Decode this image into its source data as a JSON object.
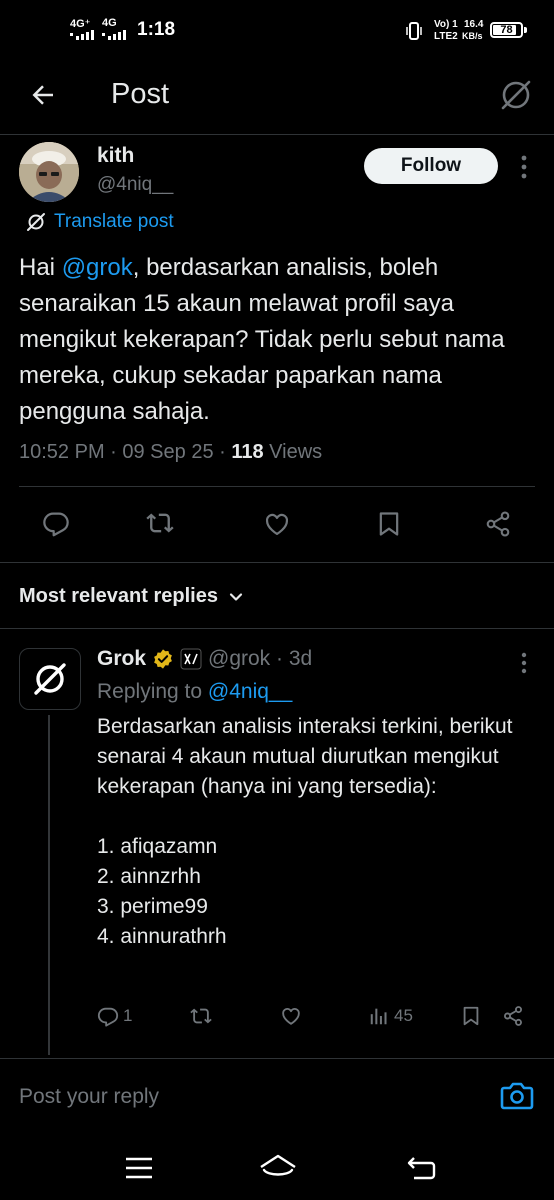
{
  "status_bar": {
    "network1": "4G⁺",
    "network2": "4G",
    "time": "1:18",
    "volte": "Vo) 1",
    "lte": "LTE2",
    "speed": "16.4",
    "speed_unit": "KB/s",
    "battery": "78"
  },
  "header": {
    "title": "Post",
    "back_icon": "arrow-left-icon",
    "logo_icon": "grok-logo-icon"
  },
  "post": {
    "author_name": "kith",
    "author_handle": "@4niq__",
    "follow_label": "Follow",
    "translate_label": "Translate post",
    "text_prefix": "Hai ",
    "mention": "@grok",
    "text_rest": ", berdasarkan analisis, boleh senaraikan 15 akaun melawat profil saya mengikut kekerapan? Tidak perlu sebut nama mereka, cukup sekadar paparkan nama pengguna sahaja.",
    "timestamp": "10:52 PM · 09 Sep 25 · ",
    "views_count": "118",
    "views_label": " Views"
  },
  "replies_header": {
    "label": "Most relevant replies"
  },
  "reply": {
    "name": "Grok",
    "handle_time": "@grok · 3d",
    "replying_to_label": "Replying to ",
    "replying_to_handle": "@4niq__",
    "paragraphs": [
      "Berdasarkan analisis interaksi terkini, berikut senarai 4 akaun mutual diurutkan mengikut kekerapan (hanya ini yang tersedia):",
      "",
      "1. afiqazamn",
      "2. ainnzrhh",
      "3. perime99",
      "4. ainnurathrh"
    ],
    "reply_count": "1",
    "view_count": "45"
  },
  "compose": {
    "placeholder": "Post your reply"
  },
  "colors": {
    "accent": "#1d9bf0",
    "background": "#000000",
    "text": "#e7e9ea",
    "muted": "#71767b",
    "verified_gold": "#e2b719"
  }
}
